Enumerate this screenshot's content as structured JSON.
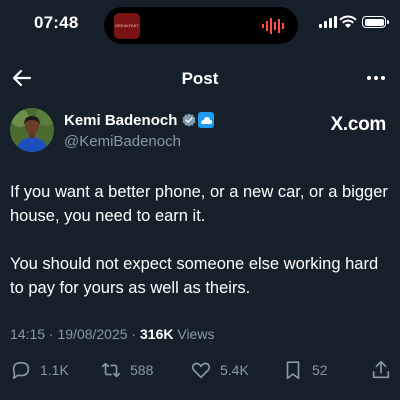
{
  "status_bar": {
    "time": "07:48",
    "now_playing_thumb_label": "BREAKFAST"
  },
  "nav": {
    "title": "Post"
  },
  "author": {
    "display_name": "Kemi Badenoch",
    "handle": "@KemiBadenoch",
    "watermark": "X.com"
  },
  "post": {
    "paragraphs": [
      "If you want a better phone, or a new car, or a bigger house, you need to earn it.",
      "You should not expect someone else working hard to pay for yours as well as theirs."
    ],
    "timestamp": "14:15 · 19/08/2025 · ",
    "views_count": "316K",
    "views_label": " Views"
  },
  "actions": {
    "replies": "1.1K",
    "reposts": "588",
    "likes": "5.4K",
    "bookmarks": "52"
  },
  "colors": {
    "background": "#15202b",
    "secondary_text": "#8b98a5",
    "verified_blue": "#1d9bf0"
  },
  "icons": [
    "back-arrow-icon",
    "more-icon",
    "verified-badge-icon",
    "affiliation-badge-icon",
    "reply-icon",
    "repost-icon",
    "like-icon",
    "bookmark-icon",
    "share-icon"
  ]
}
